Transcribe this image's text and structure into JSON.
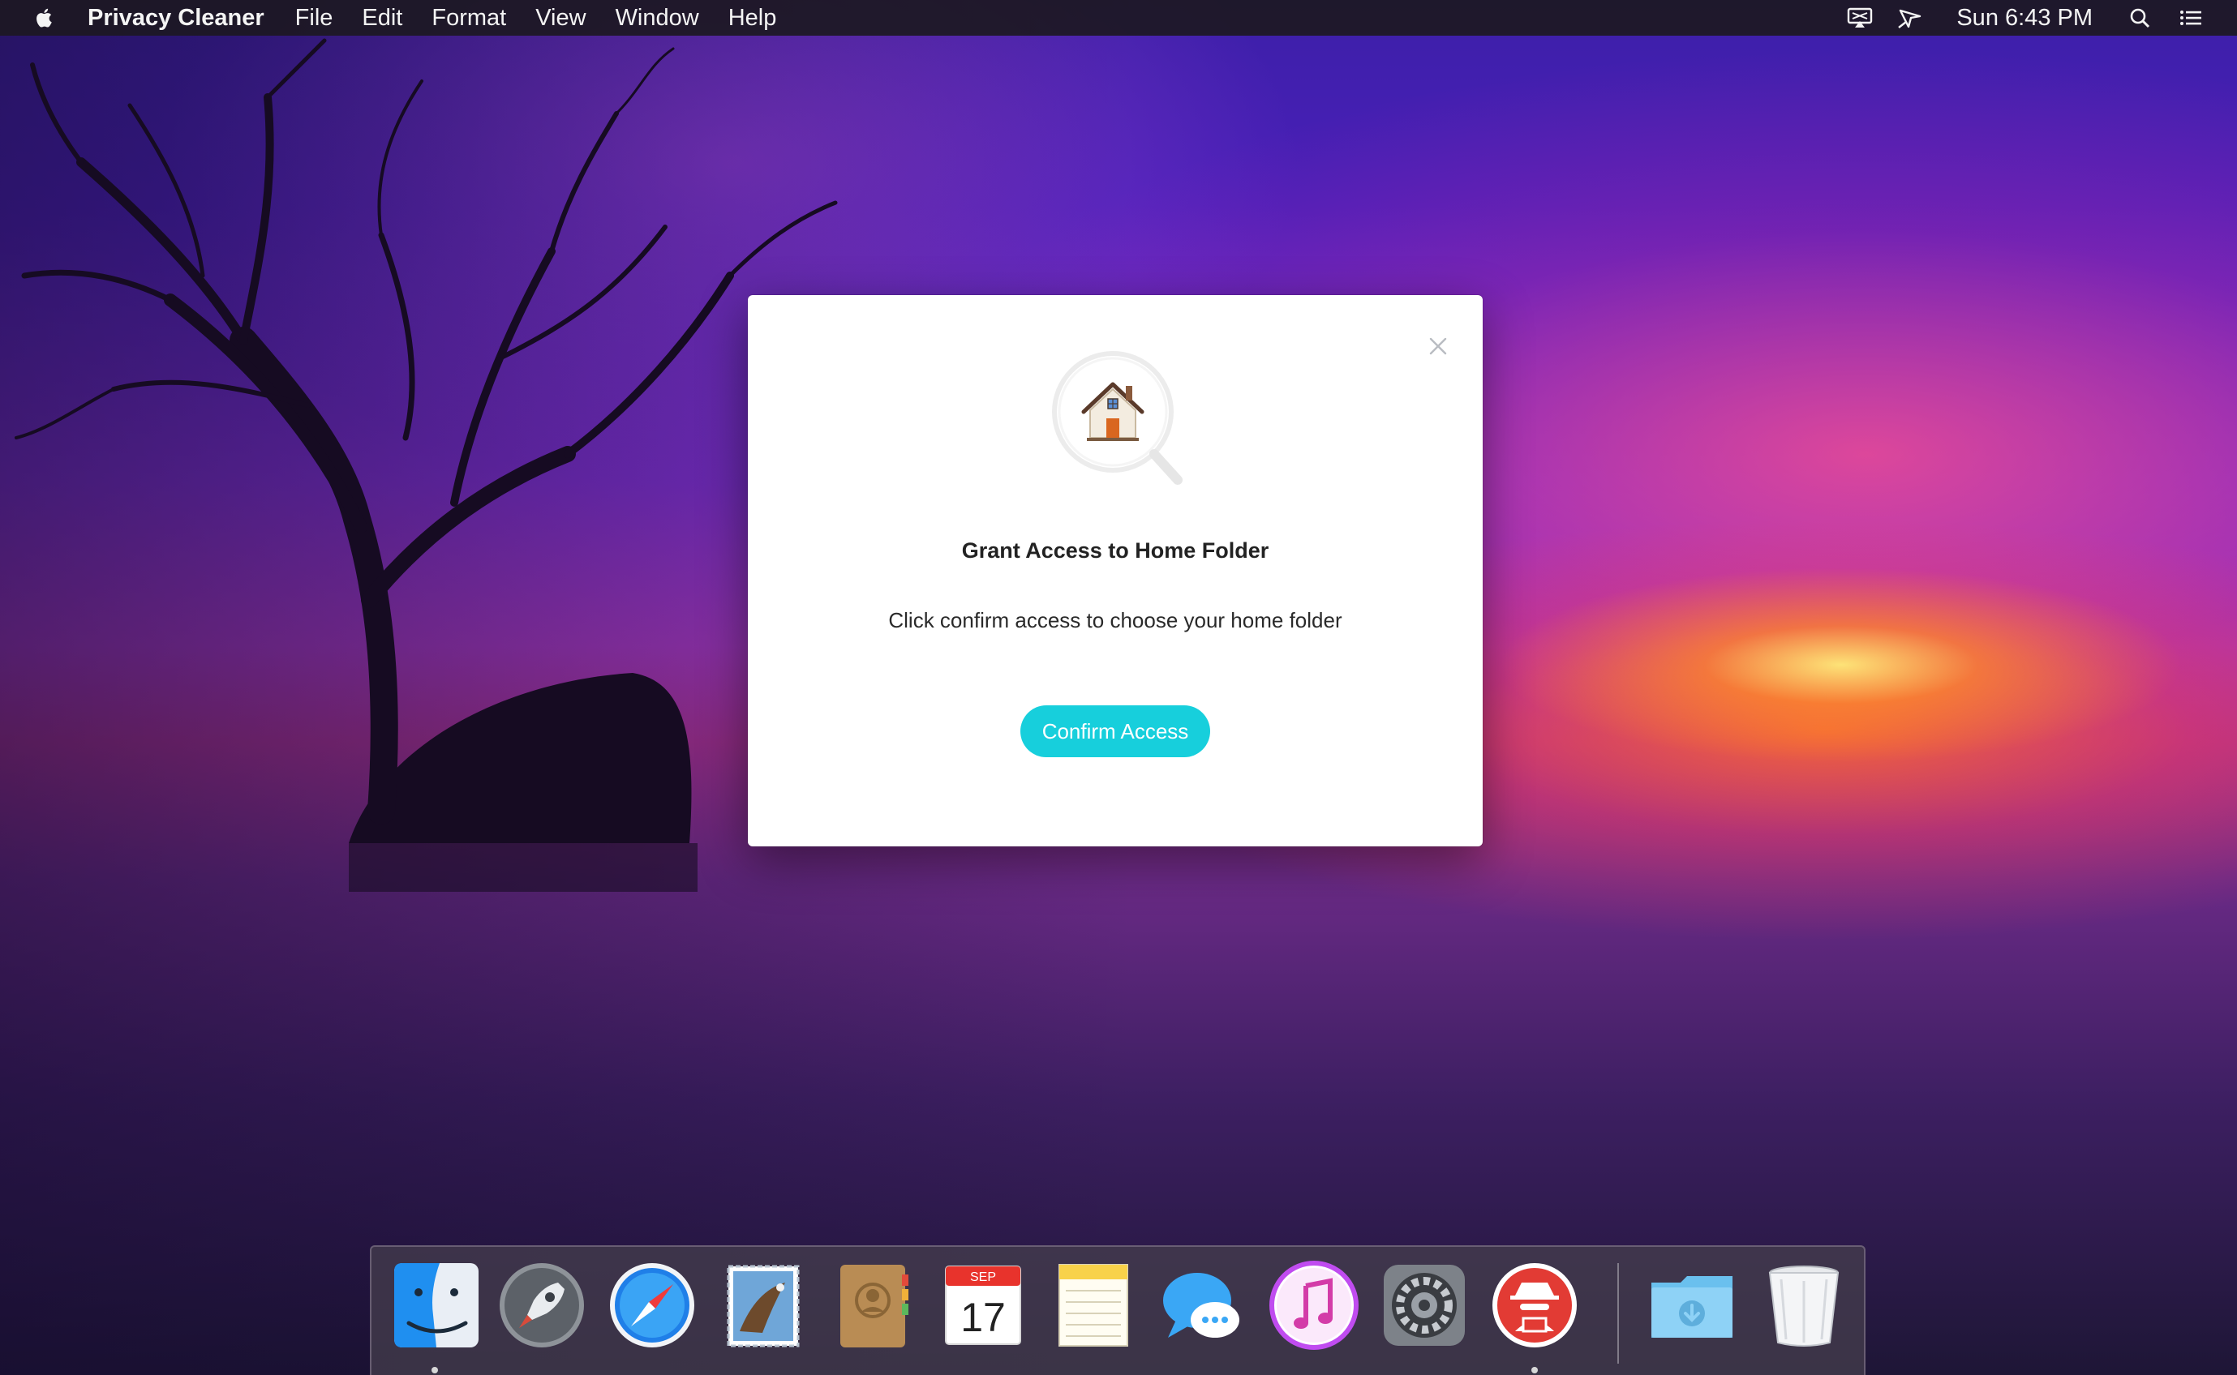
{
  "menubar": {
    "app_name": "Privacy Cleaner",
    "menus": [
      "File",
      "Edit",
      "Format",
      "View",
      "Window",
      "Help"
    ],
    "clock": "Sun 6:43 PM",
    "icons": [
      "apple-icon",
      "airplay-display-icon",
      "location-arrow-icon",
      "spotlight-search-icon",
      "notification-center-icon"
    ]
  },
  "dialog": {
    "title": "Grant Access to Home Folder",
    "message": "Click confirm access to choose your home folder",
    "confirm_label": "Confirm Access",
    "hero_icon": "home-magnifier-icon",
    "accent_color": "#17cfdc"
  },
  "dock": {
    "items": [
      {
        "name": "Finder",
        "icon": "finder-icon",
        "running": true
      },
      {
        "name": "Launchpad",
        "icon": "launchpad-rocket-icon",
        "running": false
      },
      {
        "name": "Safari",
        "icon": "safari-compass-icon",
        "running": false
      },
      {
        "name": "Mail",
        "icon": "mail-stamp-icon",
        "running": false
      },
      {
        "name": "Contacts",
        "icon": "contacts-book-icon",
        "running": false
      },
      {
        "name": "Calendar",
        "icon": "calendar-icon",
        "running": false,
        "month": "SEP",
        "day": "17"
      },
      {
        "name": "Notes",
        "icon": "notes-icon",
        "running": false
      },
      {
        "name": "Messages",
        "icon": "messages-bubble-icon",
        "running": false
      },
      {
        "name": "iTunes",
        "icon": "itunes-music-icon",
        "running": false
      },
      {
        "name": "System Preferences",
        "icon": "system-preferences-gear-icon",
        "running": false
      },
      {
        "name": "Privacy Cleaner",
        "icon": "privacy-cleaner-spy-icon",
        "running": true
      },
      {
        "name": "Downloads",
        "icon": "downloads-folder-icon",
        "running": false
      },
      {
        "name": "Trash",
        "icon": "trash-icon",
        "running": false
      }
    ]
  }
}
